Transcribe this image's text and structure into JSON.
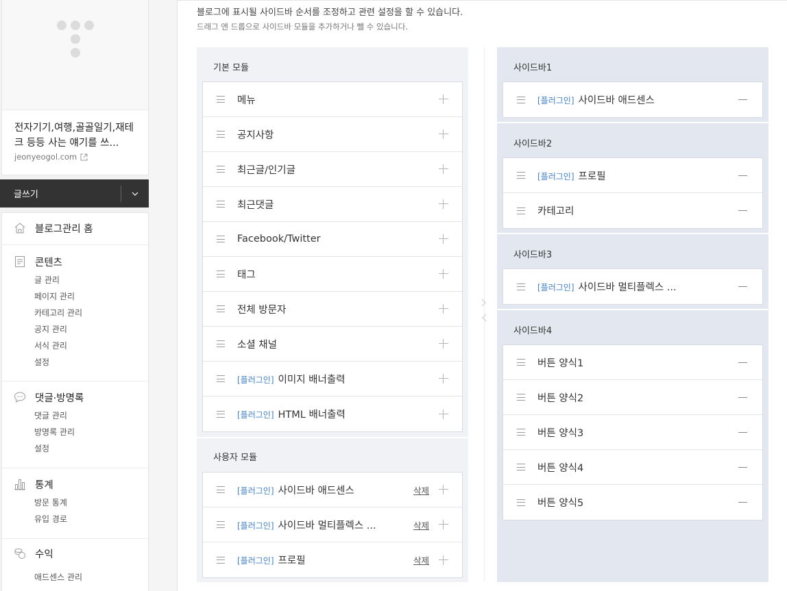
{
  "profile": {
    "blog_title": "전자기기,여행,골골일기,재테크 등등 사는 얘기를 쓰...",
    "blog_url": "jeonyeogol.com"
  },
  "write": {
    "label": "글쓰기"
  },
  "menu": {
    "home": "블로그관리 홈",
    "contents": {
      "title": "콘텐츠",
      "items": [
        "글 관리",
        "페이지 관리",
        "카테고리 관리",
        "공지 관리",
        "서식 관리",
        "설정"
      ]
    },
    "comments": {
      "title": "댓글·방명록",
      "items": [
        "댓글 관리",
        "방명록 관리",
        "설정"
      ]
    },
    "stats": {
      "title": "통계",
      "items": [
        "방문 통계",
        "유입 경로"
      ]
    },
    "revenue": {
      "title": "수익",
      "items": [
        "애드센스 관리"
      ]
    }
  },
  "header": {
    "desc1": "블로그에 표시될 사이드바 순서를 조정하고 관련 설정을 할 수 있습니다.",
    "desc2": "드래그 앤 드롭으로 사이드바 모듈을 추가하거나 뺄 수 있습니다."
  },
  "plugin_tag": "[플러그인]",
  "delete_label": "삭제",
  "basic_modules": {
    "title": "기본 모듈",
    "items": [
      {
        "label": "메뉴",
        "plugin": false
      },
      {
        "label": "공지사항",
        "plugin": false
      },
      {
        "label": "최근글/인기글",
        "plugin": false
      },
      {
        "label": "최근댓글",
        "plugin": false
      },
      {
        "label": "Facebook/Twitter",
        "plugin": false
      },
      {
        "label": "태그",
        "plugin": false
      },
      {
        "label": "전체 방문자",
        "plugin": false
      },
      {
        "label": "소셜 채널",
        "plugin": false
      },
      {
        "label": "이미지 배너출력",
        "plugin": true
      },
      {
        "label": "HTML 배너출력",
        "plugin": true
      }
    ]
  },
  "user_modules": {
    "title": "사용자 모듈",
    "items": [
      {
        "label": "사이드바 애드센스",
        "plugin": true
      },
      {
        "label": "사이드바 멀티플렉스 ...",
        "plugin": true
      },
      {
        "label": "프로필",
        "plugin": true
      }
    ]
  },
  "sidebars": [
    {
      "title": "사이드바1",
      "items": [
        {
          "label": "사이드바 애드센스",
          "plugin": true
        }
      ]
    },
    {
      "title": "사이드바2",
      "items": [
        {
          "label": "프로필",
          "plugin": true
        },
        {
          "label": "카테고리",
          "plugin": false
        }
      ]
    },
    {
      "title": "사이드바3",
      "items": [
        {
          "label": "사이드바 멀티플렉스 ...",
          "plugin": true
        }
      ]
    },
    {
      "title": "사이드바4",
      "items": [
        {
          "label": "버튼 양식1",
          "plugin": false
        },
        {
          "label": "버튼 양식2",
          "plugin": false
        },
        {
          "label": "버튼 양식3",
          "plugin": false
        },
        {
          "label": "버튼 양식4",
          "plugin": false
        },
        {
          "label": "버튼 양식5",
          "plugin": false
        }
      ]
    }
  ],
  "icons": {
    "home": "home-icon",
    "contents": "document-icon",
    "comments": "speech-bubble-icon",
    "stats": "bar-chart-icon",
    "revenue": "coins-icon",
    "external": "external-link-icon",
    "drag": "drag-handle-icon",
    "add": "plus-icon",
    "remove": "minus-icon"
  }
}
